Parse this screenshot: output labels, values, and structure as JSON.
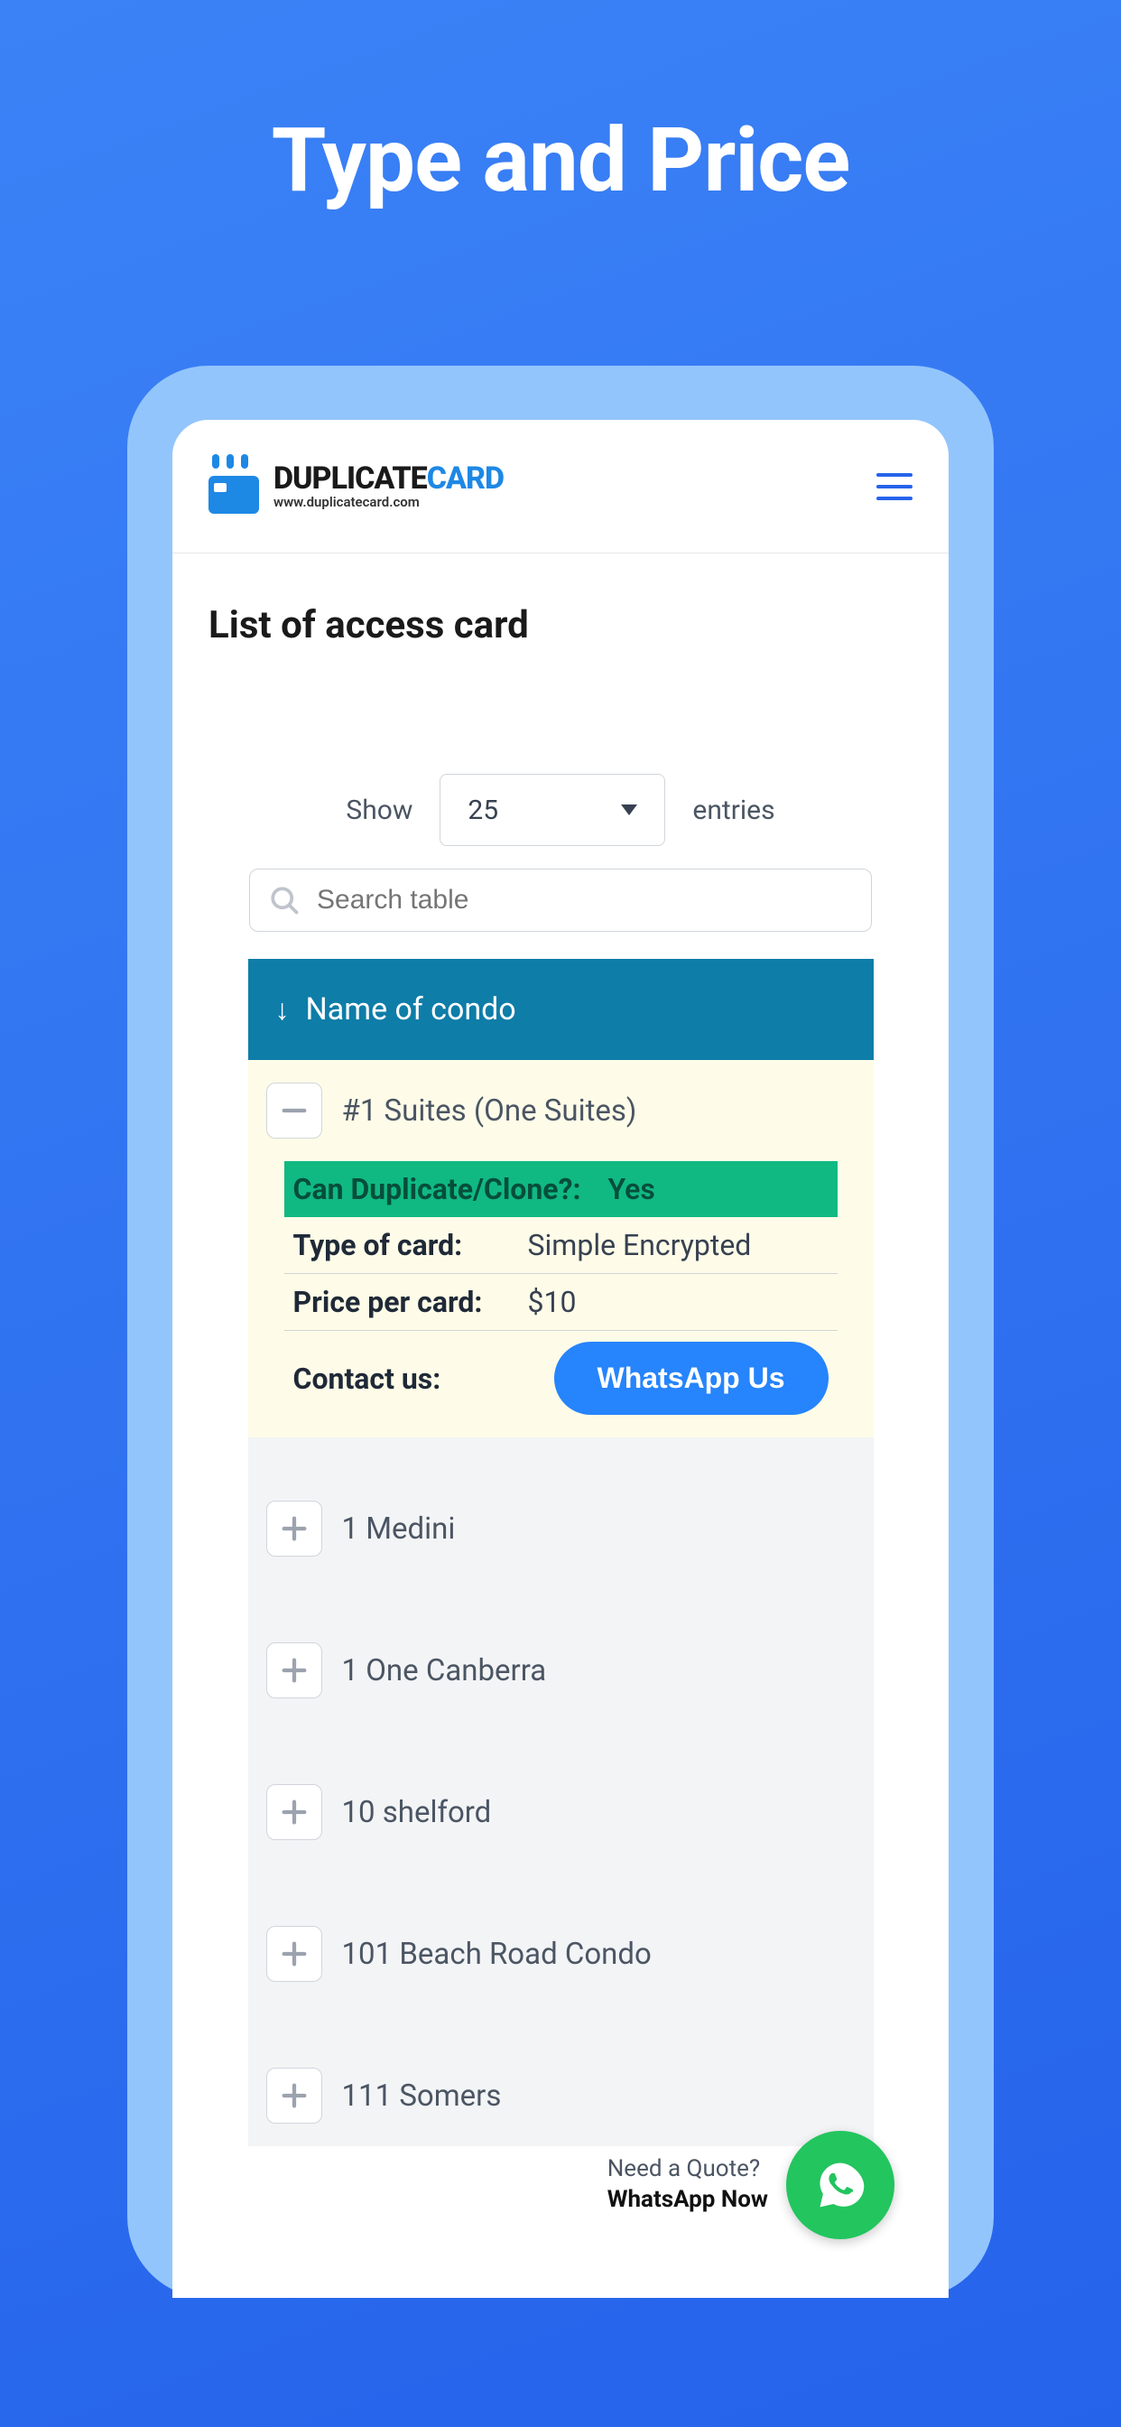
{
  "hero": {
    "title": "Type and Price"
  },
  "header": {
    "logo_main_1": "DUPLICATE",
    "logo_main_2": "CARD",
    "logo_sub": "www.duplicatecard.com"
  },
  "page": {
    "title": "List of access card"
  },
  "controls": {
    "show_label": "Show",
    "entries_label": "entries",
    "selected_count": "25",
    "search_placeholder": "Search table"
  },
  "table": {
    "header": "Name of condo",
    "expanded_row": {
      "name": "#1 Suites (One Suites)",
      "details": {
        "can_duplicate_label": "Can Duplicate/Clone?:",
        "can_duplicate_value": "Yes",
        "type_label": "Type of card:",
        "type_value": "Simple Encrypted",
        "price_label": "Price per card:",
        "price_value": "$10",
        "contact_label": "Contact us:",
        "whatsapp_button": "WhatsApp Us"
      }
    },
    "rows": [
      {
        "name": "1 Medini"
      },
      {
        "name": "1 One Canberra"
      },
      {
        "name": "10 shelford"
      },
      {
        "name": "101 Beach Road Condo"
      },
      {
        "name": "111 Somers"
      }
    ]
  },
  "fab": {
    "line1": "Need a Quote?",
    "line2": "WhatsApp Now"
  }
}
